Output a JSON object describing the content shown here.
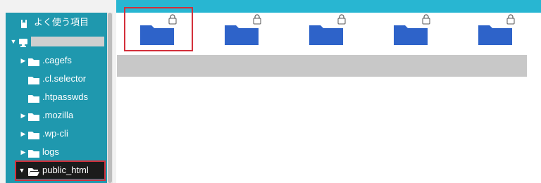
{
  "colors": {
    "topbar": "#28b6d2",
    "tree_bg": "#1f98ae",
    "folder_blue": "#2e63c9",
    "highlight_red": "#d32f3a",
    "selected_row": "#1b1b1b"
  },
  "sidebar": {
    "favorites_label": "よく使う項目",
    "favorites_icon": "bookmark-icon",
    "root_icon": "computer-icon",
    "items": [
      {
        "label": ".cagefs",
        "expandable": true,
        "icon": "folder-icon"
      },
      {
        "label": ".cl.selector",
        "expandable": false,
        "icon": "folder-icon"
      },
      {
        "label": ".htpasswds",
        "expandable": false,
        "icon": "folder-icon"
      },
      {
        "label": ".mozilla",
        "expandable": true,
        "icon": "folder-icon"
      },
      {
        "label": ".wp-cli",
        "expandable": true,
        "icon": "folder-icon"
      },
      {
        "label": "logs",
        "expandable": true,
        "icon": "folder-icon"
      },
      {
        "label": "public_html",
        "expandable": true,
        "expanded": true,
        "selected": true,
        "icon": "folder-open-icon"
      }
    ]
  },
  "main": {
    "folders": [
      {
        "icon": "folder-icon",
        "locked": true
      },
      {
        "icon": "folder-icon",
        "locked": true
      },
      {
        "icon": "folder-icon",
        "locked": true
      },
      {
        "icon": "folder-icon",
        "locked": true
      },
      {
        "icon": "folder-icon",
        "locked": true
      }
    ]
  }
}
